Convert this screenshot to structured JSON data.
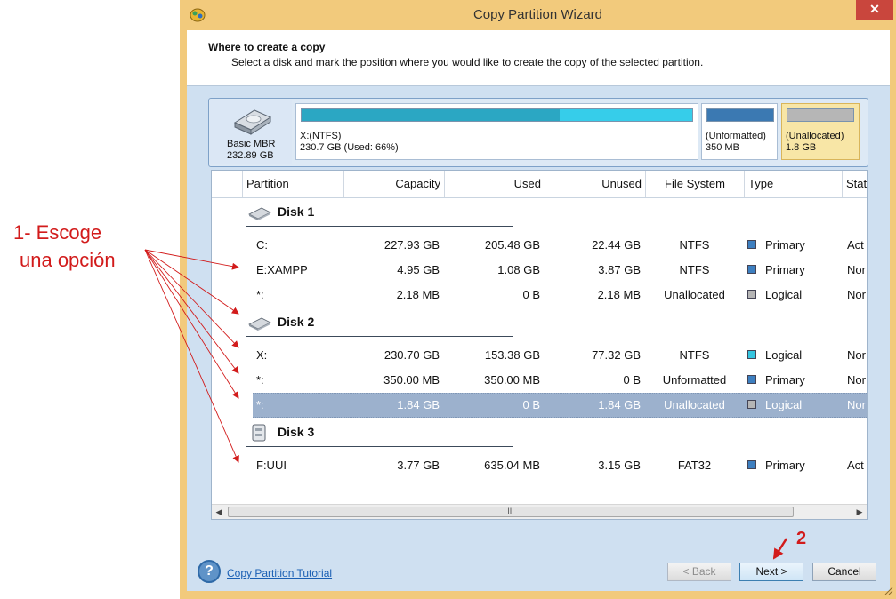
{
  "annotations": {
    "step1_line1": "1- Escoge",
    "step1_line2": "una opción",
    "step2": "2"
  },
  "window": {
    "title": "Copy Partition Wizard",
    "close_glyph": "✕"
  },
  "header": {
    "title": "Where to create a copy",
    "subtitle": "Select a disk and mark the position where you would like to create the copy of the selected partition."
  },
  "disk_map": {
    "disk_type": "Basic MBR",
    "disk_size": "232.89 GB",
    "partitions": [
      {
        "label": "X:(NTFS)",
        "detail": "230.7 GB (Used: 66%)",
        "used_fraction": 0.66,
        "used_color": "#2ba7c3",
        "free_color": "#36cdea"
      },
      {
        "label": "(Unformatted)",
        "detail": "350 MB",
        "used_fraction": 1.0,
        "used_color": "#3b79b2",
        "free_color": "#3b79b2"
      },
      {
        "label": "(Unallocated)",
        "detail": "1.8 GB",
        "used_fraction": 1.0,
        "used_color": "#b6b6b6",
        "free_color": "#b6b6b6",
        "selected": true
      }
    ]
  },
  "columns": [
    "Partition",
    "Capacity",
    "Used",
    "Unused",
    "File System",
    "Type",
    "Stat"
  ],
  "scroll_thumb": "III",
  "disks": [
    {
      "name": "Disk 1",
      "partitions": [
        {
          "partition": "C:",
          "capacity": "227.93 GB",
          "used": "205.48 GB",
          "unused": "22.44 GB",
          "fs": "NTFS",
          "type": "Primary",
          "type_color": "#3d7fc0",
          "status": "Act"
        },
        {
          "partition": "E:XAMPP",
          "capacity": "4.95 GB",
          "used": "1.08 GB",
          "unused": "3.87 GB",
          "fs": "NTFS",
          "type": "Primary",
          "type_color": "#3d7fc0",
          "status": "Nor"
        },
        {
          "partition": "*:",
          "capacity": "2.18 MB",
          "used": "0 B",
          "unused": "2.18 MB",
          "fs": "Unallocated",
          "type": "Logical",
          "type_color": "#b5b5b5",
          "status": "Nor"
        }
      ]
    },
    {
      "name": "Disk 2",
      "partitions": [
        {
          "partition": "X:",
          "capacity": "230.70 GB",
          "used": "153.38 GB",
          "unused": "77.32 GB",
          "fs": "NTFS",
          "type": "Logical",
          "type_color": "#35c5e0",
          "status": "Nor"
        },
        {
          "partition": "*:",
          "capacity": "350.00 MB",
          "used": "350.00 MB",
          "unused": "0 B",
          "fs": "Unformatted",
          "type": "Primary",
          "type_color": "#3d7fc0",
          "status": "Nor"
        },
        {
          "partition": "*:",
          "capacity": "1.84 GB",
          "used": "0 B",
          "unused": "1.84 GB",
          "fs": "Unallocated",
          "type": "Logical",
          "type_color": "#b5b5b5",
          "status": "Nor",
          "selected": true
        }
      ]
    },
    {
      "name": "Disk 3",
      "partitions": [
        {
          "partition": "F:UUI",
          "capacity": "3.77 GB",
          "used": "635.04 MB",
          "unused": "3.15 GB",
          "fs": "FAT32",
          "type": "Primary",
          "type_color": "#3d7fc0",
          "status": "Act"
        }
      ]
    }
  ],
  "footer": {
    "help_glyph": "?",
    "tutorial_link": "Copy Partition Tutorial",
    "back": "< Back",
    "next": "Next >",
    "cancel": "Cancel"
  }
}
